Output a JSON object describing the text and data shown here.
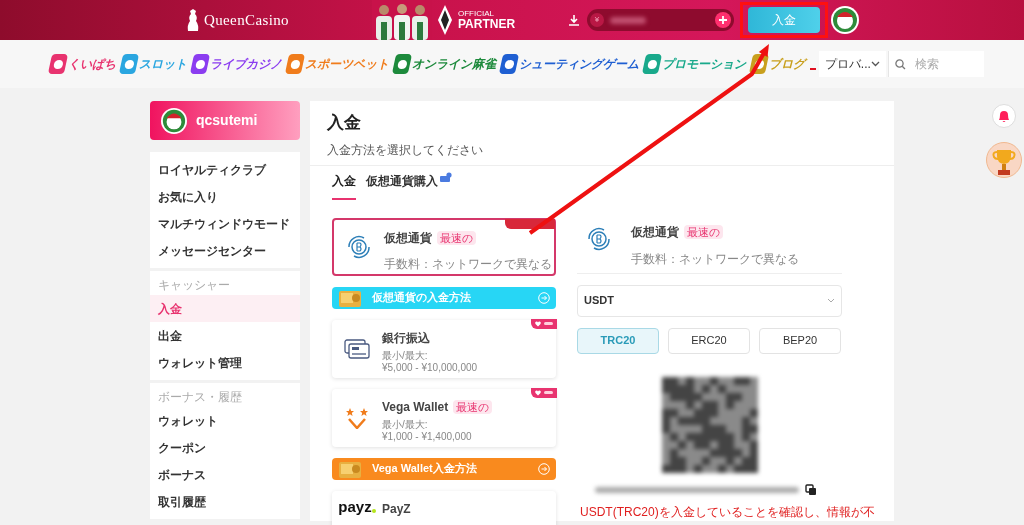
{
  "header": {
    "logo": "QueenCasino",
    "partner": {
      "line1": "OFFICIAL",
      "line2": "PARTNER"
    },
    "balance": {
      "currency": "¥"
    },
    "deposit_button": "入金"
  },
  "nav": {
    "items": [
      {
        "label": "くいぱち",
        "color": "#e8336f"
      },
      {
        "label": "スロット",
        "color": "#2aa6e0"
      },
      {
        "label": "ライブカジノ",
        "color": "#8b3df0"
      },
      {
        "label": "スポーツベット",
        "color": "#f07c1c"
      },
      {
        "label": "オンライン麻雀",
        "color": "#1d8a3c"
      },
      {
        "label": "シューティングゲーム",
        "color": "#1f5fd2"
      },
      {
        "label": "プロモーション",
        "color": "#19a98b"
      },
      {
        "label": "ブログ",
        "color": "#c9a01e"
      }
    ],
    "provider": "プロバ...",
    "search": {
      "placeholder": "検索"
    }
  },
  "user": {
    "name": "qcsutemi"
  },
  "sidebar": {
    "groups": [
      {
        "items": [
          {
            "label": "ロイヤルティクラブ",
            "selected": false
          },
          {
            "label": "お気に入り",
            "selected": false
          },
          {
            "label": "マルチウィンドウモード",
            "selected": false
          },
          {
            "label": "メッセージセンター",
            "selected": false
          }
        ]
      },
      {
        "title": "キャッシャー",
        "items": [
          {
            "label": "入金",
            "selected": true
          },
          {
            "label": "出金",
            "selected": false
          },
          {
            "label": "ウォレット管理",
            "selected": false
          }
        ]
      },
      {
        "title": "ボーナス・履歴",
        "items": [
          {
            "label": "ウォレット",
            "selected": false
          },
          {
            "label": "クーポン",
            "selected": false
          },
          {
            "label": "ボーナス",
            "selected": false
          },
          {
            "label": "取引履歴",
            "selected": false
          }
        ]
      }
    ]
  },
  "main": {
    "title": "入金",
    "subtitle": "入金方法を選択してください",
    "tabs": [
      {
        "label": "入金",
        "selected": true
      },
      {
        "label": "仮想通貨購入",
        "selected": false
      }
    ],
    "methods": [
      {
        "kind": "crypto",
        "name": "仮想通貨",
        "tag": "最速の",
        "lines": [
          "手数料：ネットワークで異なる"
        ],
        "bonus_badge": true,
        "selected": true
      },
      {
        "kind": "guide",
        "label": "仮想通貨の入金方法",
        "color": "#27d6f5"
      },
      {
        "kind": "bank",
        "name": "銀行振込",
        "lines": [
          "最小/最大:",
          "¥5,000 - ¥10,000,000"
        ],
        "featured": true,
        "selected": false
      },
      {
        "kind": "vega",
        "name": "Vega Wallet",
        "tag": "最速の",
        "lines": [
          "最小/最大:",
          "¥1,000 - ¥1,400,000"
        ],
        "featured": true,
        "selected": false
      },
      {
        "kind": "guide",
        "label": "Vega Wallet入金方法",
        "color": "#f98a1e"
      },
      {
        "kind": "payz",
        "logo_text": "payz",
        "name": "PayZ",
        "selected": false
      }
    ],
    "detail": {
      "name": "仮想通貨",
      "tag": "最速の",
      "fee": "手数料：ネットワークで異なる",
      "currency": "USDT",
      "networks": [
        {
          "label": "TRC20",
          "selected": true
        },
        {
          "label": "ERC20",
          "selected": false
        },
        {
          "label": "BEP20",
          "selected": false
        }
      ],
      "warning": "USDT(TRC20)を入金していることを確認し、情報が不"
    }
  }
}
